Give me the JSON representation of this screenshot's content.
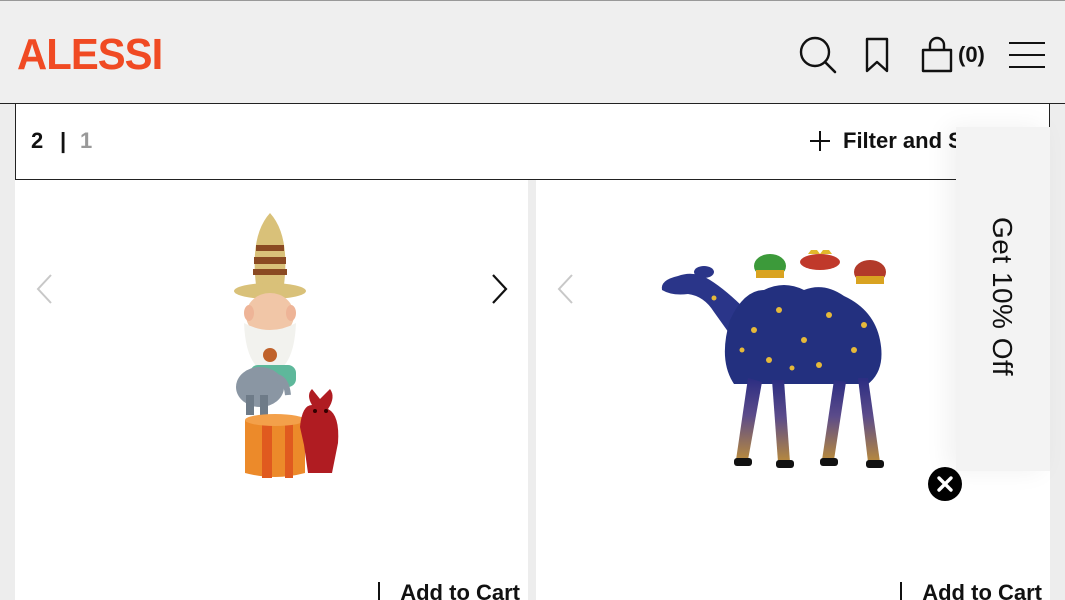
{
  "header": {
    "logo": "ALESSI",
    "cart_count": "(0)",
    "icons": [
      "search-icon",
      "bookmark-icon",
      "shopping-bag-icon",
      "menu-icon"
    ],
    "brand_color": "#f04a23"
  },
  "toolbar": {
    "page_current": "2",
    "separator": "|",
    "page_other": "1",
    "filter_label": "Filter and S"
  },
  "products": [
    {
      "image_icon": "gnome-figurine-with-cat-image",
      "add_to_cart": "Add to Cart"
    },
    {
      "image_icon": "starry-camel-figurine-image",
      "add_to_cart": "Add to Cart"
    }
  ],
  "promo": {
    "label": "Get 10% Off"
  }
}
